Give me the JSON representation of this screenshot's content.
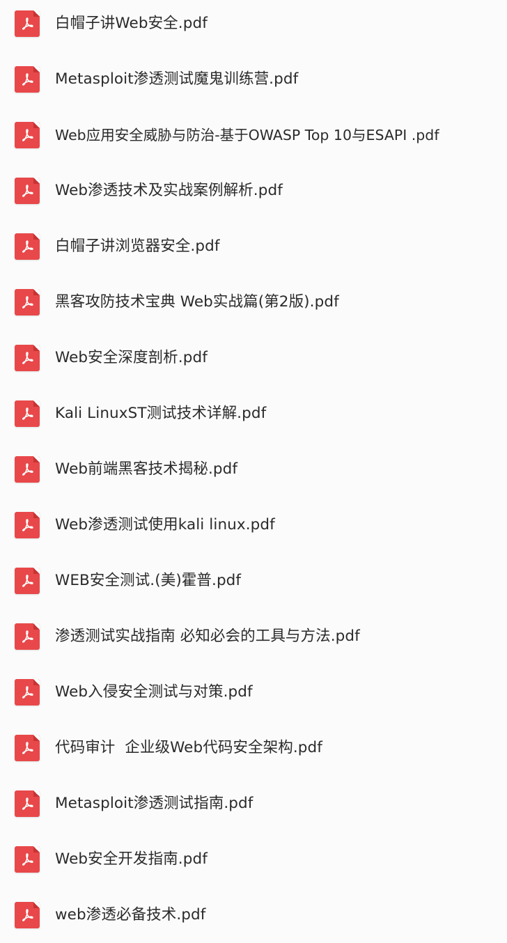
{
  "files": [
    {
      "name": "白帽子讲Web安全.pdf",
      "icon": "pdf-file-icon"
    },
    {
      "name": "Metasploit渗透测试魔鬼训练营.pdf",
      "icon": "pdf-file-icon"
    },
    {
      "name": "Web应用安全威胁与防治-基于OWASP Top 10与ESAPI .pdf",
      "icon": "pdf-file-icon"
    },
    {
      "name": "Web渗透技术及实战案例解析.pdf",
      "icon": "pdf-file-icon"
    },
    {
      "name": "白帽子讲浏览器安全.pdf",
      "icon": "pdf-file-icon"
    },
    {
      "name": "黑客攻防技术宝典 Web实战篇(第2版).pdf",
      "icon": "pdf-file-icon"
    },
    {
      "name": "Web安全深度剖析.pdf",
      "icon": "pdf-file-icon"
    },
    {
      "name": "Kali LinuxST测试技术详解.pdf",
      "icon": "pdf-file-icon"
    },
    {
      "name": "Web前端黑客技术揭秘.pdf",
      "icon": "pdf-file-icon"
    },
    {
      "name": "Web渗透测试使用kali linux.pdf",
      "icon": "pdf-file-icon"
    },
    {
      "name": "WEB安全测试.(美)霍普.pdf",
      "icon": "pdf-file-icon"
    },
    {
      "name": "渗透测试实战指南 必知必会的工具与方法.pdf",
      "icon": "pdf-file-icon"
    },
    {
      "name": "Web入侵安全测试与对策.pdf",
      "icon": "pdf-file-icon"
    },
    {
      "name": "代码审计  企业级Web代码安全架构.pdf",
      "icon": "pdf-file-icon"
    },
    {
      "name": "Metasploit渗透测试指南.pdf",
      "icon": "pdf-file-icon"
    },
    {
      "name": "Web安全开发指南.pdf",
      "icon": "pdf-file-icon"
    },
    {
      "name": "web渗透必备技术.pdf",
      "icon": "pdf-file-icon"
    }
  ],
  "colors": {
    "icon_red": "#e8484a",
    "text": "#2a2a2a",
    "background": "#fbfbfb"
  }
}
